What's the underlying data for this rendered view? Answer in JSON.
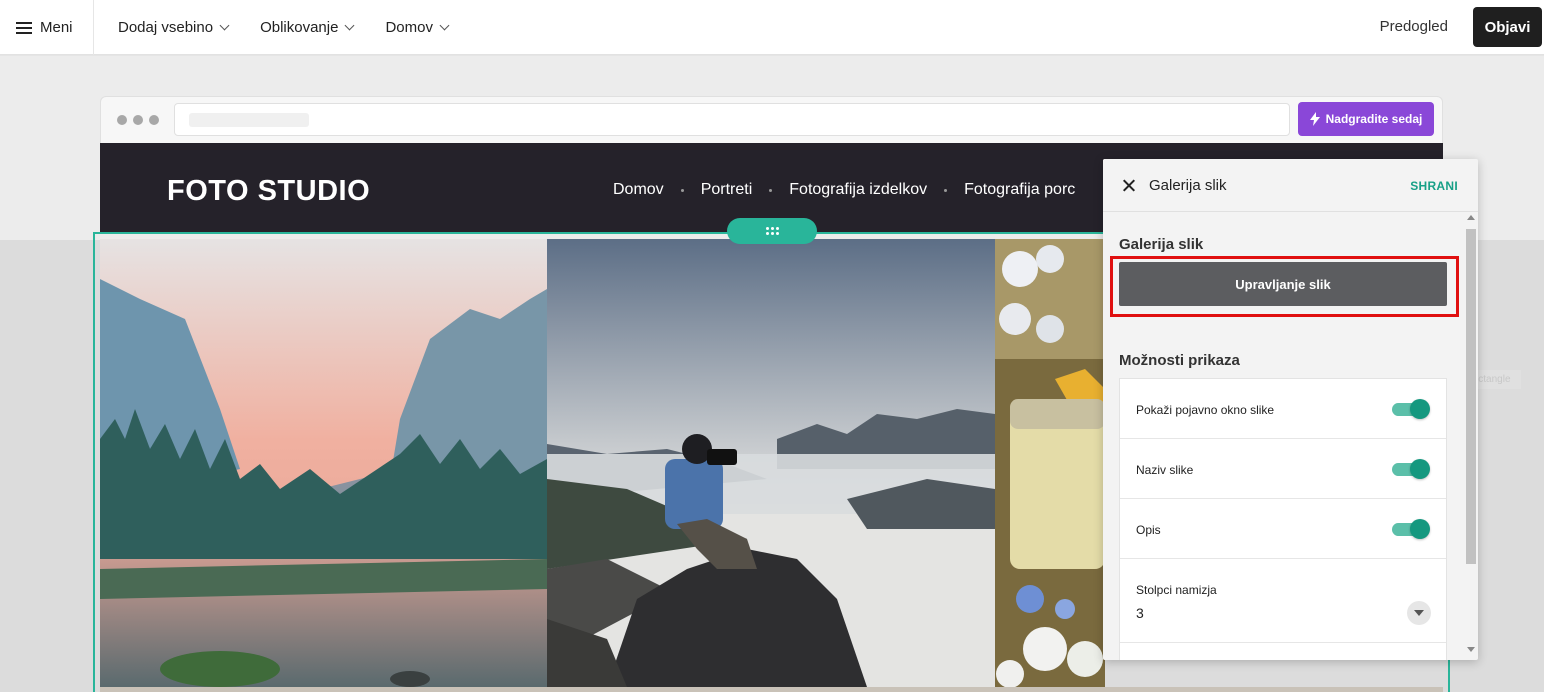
{
  "topbar": {
    "menu_label": "Meni",
    "nav": [
      "Dodaj vsebino",
      "Oblikovanje",
      "Domov"
    ],
    "preview_label": "Predogled",
    "publish_label": "Objavi"
  },
  "browser": {
    "upgrade_label": "Nadgradite sedaj"
  },
  "site": {
    "logo": "FOTO STUDIO",
    "nav": [
      "Domov",
      "Portreti",
      "Fotografija izdelkov",
      "Fotografija porc"
    ]
  },
  "canvas": {
    "ghost_label": "Rectangle"
  },
  "panel": {
    "title": "Galerija slik",
    "save_label": "SHRANI",
    "gallery_section": "Galerija slik",
    "manage_button": "Upravljanje slik",
    "display_section": "Možnosti prikaza",
    "options": [
      {
        "label": "Pokaži pojavno okno slike",
        "enabled": true
      },
      {
        "label": "Naziv slike",
        "enabled": true
      },
      {
        "label": "Opis",
        "enabled": true
      }
    ],
    "columns_label": "Stolpci namizja",
    "columns_value": "3"
  },
  "colors": {
    "accent_teal": "#29b59a",
    "upgrade_purple": "#8a47d8",
    "highlight_red": "#e01010",
    "site_header": "#25222a"
  }
}
